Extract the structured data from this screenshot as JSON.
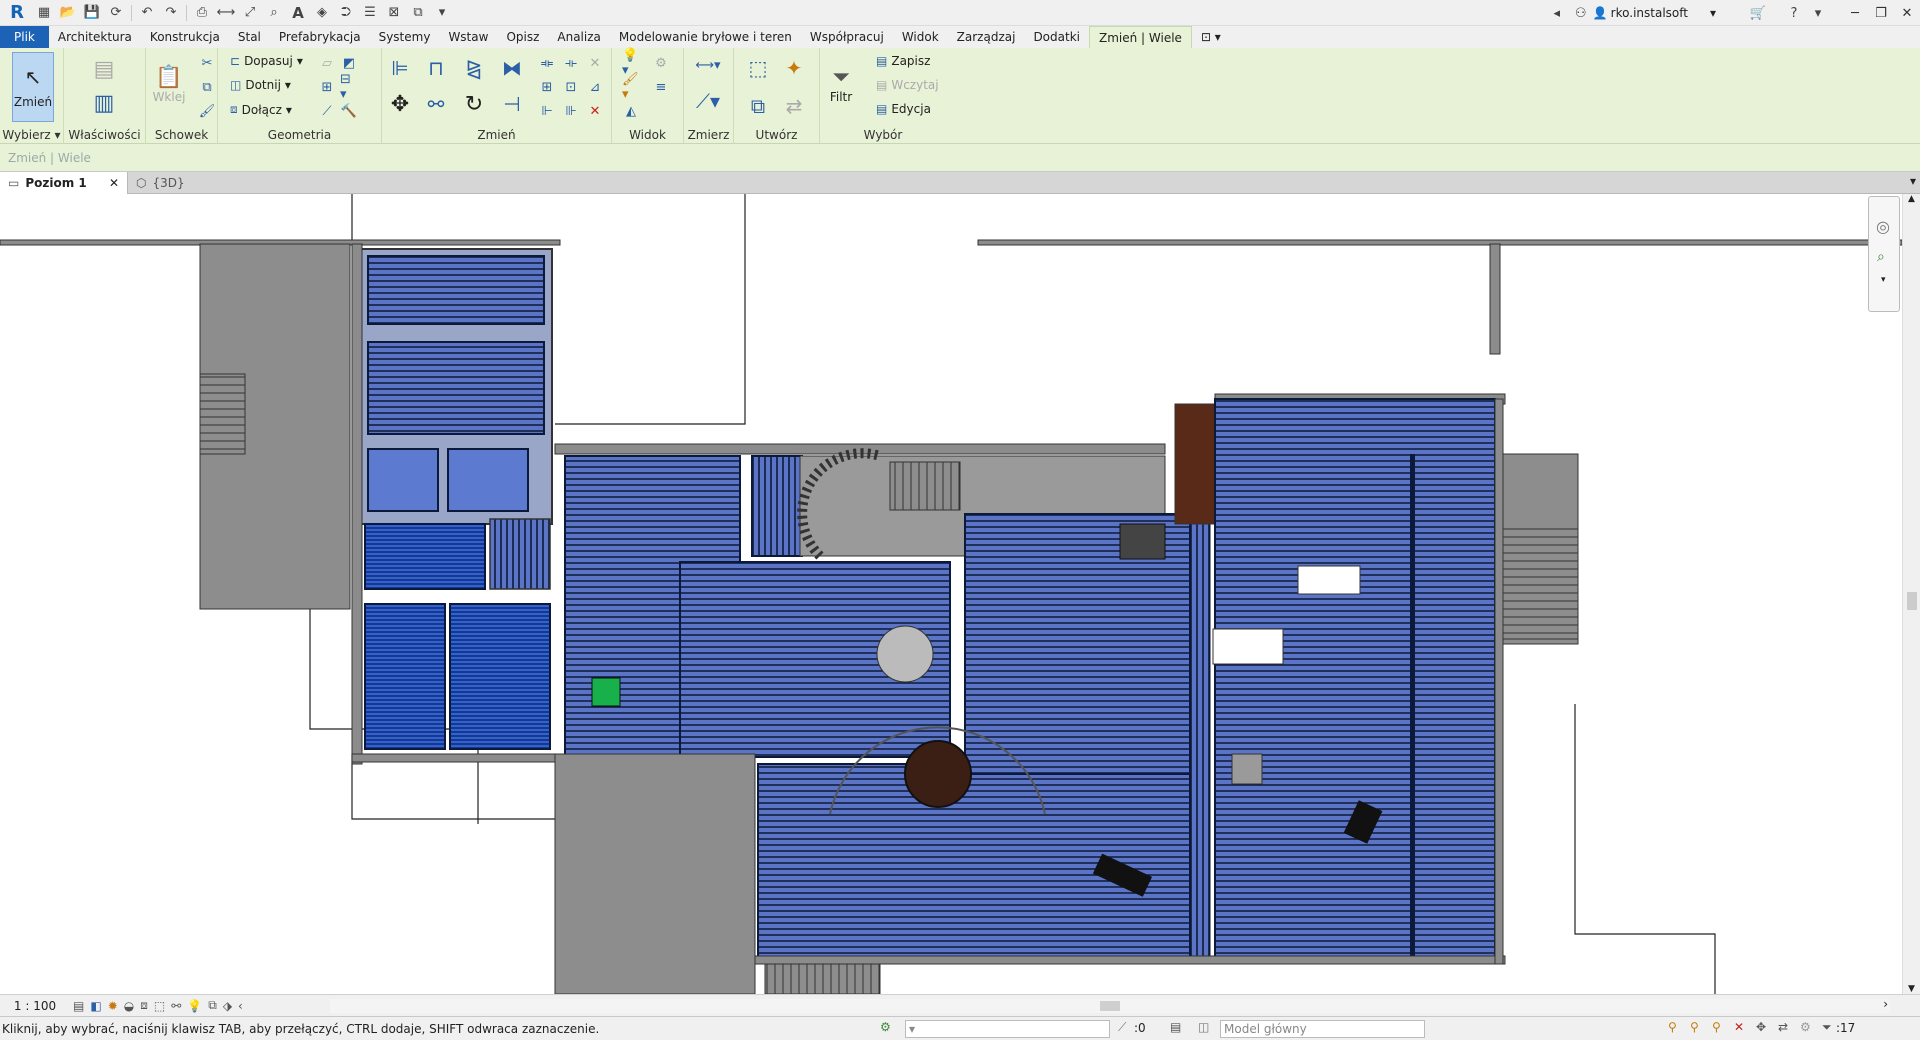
{
  "qat": {
    "user": "rko.instalsoft"
  },
  "tabs": [
    {
      "label": "Plik"
    },
    {
      "label": "Architektura"
    },
    {
      "label": "Konstrukcja"
    },
    {
      "label": "Stal"
    },
    {
      "label": "Prefabrykacja"
    },
    {
      "label": "Systemy"
    },
    {
      "label": "Wstaw"
    },
    {
      "label": "Opisz"
    },
    {
      "label": "Analiza"
    },
    {
      "label": "Modelowanie bryłowe i teren"
    },
    {
      "label": "Współpracuj"
    },
    {
      "label": "Widok"
    },
    {
      "label": "Zarządzaj"
    },
    {
      "label": "Dodatki"
    },
    {
      "label": "Zmień | Wiele"
    }
  ],
  "ribbon": {
    "modify_label": "Zmień",
    "select_label": "Wybierz",
    "properties_label": "Właściwości",
    "paste_label": "Wklej",
    "clipboard_label": "Schowek",
    "fit_label": "Dopasuj",
    "cut_label": "Dotnij",
    "join_label": "Dołącz",
    "geometry_label": "Geometria",
    "modify_group_label": "Zmień",
    "view_label": "Widok",
    "measure_label": "Zmierz",
    "create_label": "Utwórz",
    "filter_label": "Filtr",
    "save_label": "Zapisz",
    "load_label": "Wczytaj",
    "edit_label": "Edycja",
    "selection_label": "Wybór"
  },
  "optbar": {
    "text": "Zmień | Wiele"
  },
  "views": [
    {
      "label": "Poziom 1"
    },
    {
      "label": "{3D}"
    }
  ],
  "viewcontrol": {
    "scale": "1 : 100"
  },
  "status": {
    "message": "Kliknij, aby wybrać, naciśnij klawisz TAB, aby przełączyć, CTRL dodaje, SHIFT odwraca zaznaczenie.",
    "selection_count": ":0",
    "model": "Model główny",
    "filter_count": ":17"
  },
  "colors": {
    "floor_heating": "#5b74c6",
    "pipe": "#0b1a3a",
    "wall": "#8c8c8c",
    "ribbon_bg": "#e8f2d6",
    "file_tab": "#1c63b7"
  }
}
